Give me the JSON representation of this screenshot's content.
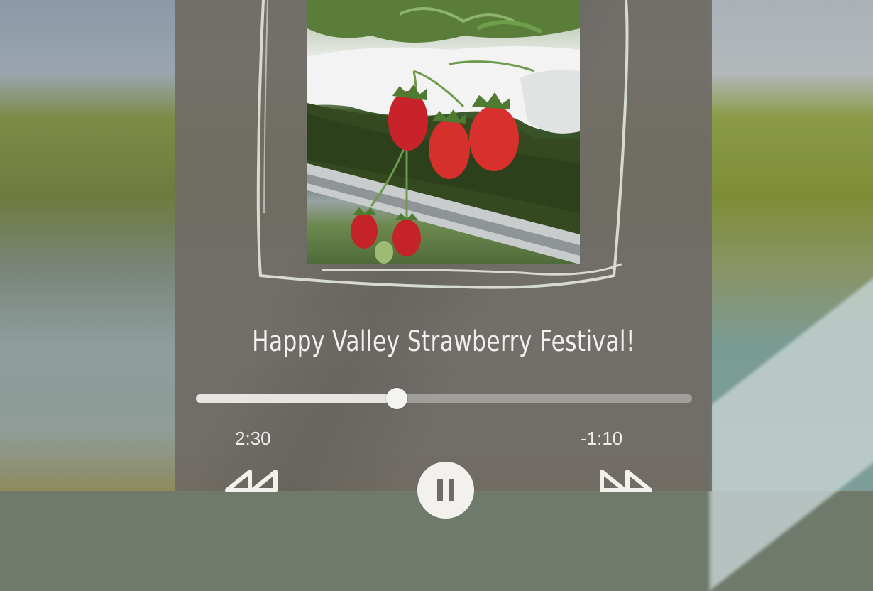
{
  "player": {
    "track_title": "Happy Valley Strawberry Festival!",
    "elapsed": "2:30",
    "remaining": "-1:10",
    "progress": 0.405
  },
  "controls": {
    "rewind_icon": "rewind-icon",
    "pause_icon": "pause-icon",
    "forward_icon": "fast-forward-icon"
  },
  "colors": {
    "panel": "#706c66",
    "text": "#f2f1ee",
    "frame": "#d9ddd4"
  }
}
